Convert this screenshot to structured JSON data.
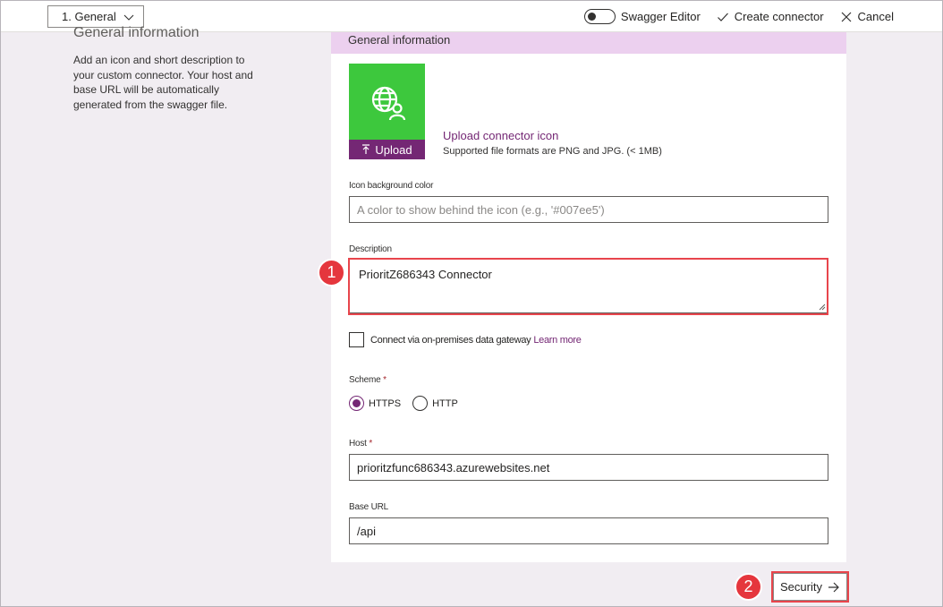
{
  "topbar": {
    "step_dropdown": "1. General",
    "swagger_editor": "Swagger Editor",
    "create_connector": "Create connector",
    "cancel": "Cancel"
  },
  "left": {
    "title": "General information",
    "description": "Add an icon and short description to your custom connector. Your host and base URL will be automatically generated from the swagger file."
  },
  "card": {
    "header": "General information",
    "upload_button": "Upload",
    "upload_link": "Upload connector icon",
    "upload_note": "Supported file formats are PNG and JPG. (< 1MB)",
    "icon_bg_label": "Icon background color",
    "icon_bg_placeholder": "A color to show behind the icon (e.g., '#007ee5')",
    "description_label": "Description",
    "description_value": "PrioritZ686343 Connector",
    "gateway_label": "Connect via on-premises data gateway",
    "learn_more": "Learn more",
    "scheme_label": "Scheme",
    "scheme_options": [
      "HTTPS",
      "HTTP"
    ],
    "scheme_selected": "HTTPS",
    "host_label": "Host",
    "host_value": "prioritzfunc686343.azurewebsites.net",
    "base_url_label": "Base URL",
    "base_url_value": "/api",
    "required_mark": "*"
  },
  "footer": {
    "security_button": "Security"
  },
  "annotations": {
    "badge1": "1",
    "badge2": "2"
  },
  "colors": {
    "accent": "#742774",
    "header_bg": "#ecd0ef",
    "icon_tile": "#3dc83d",
    "highlight": "#e8454c"
  }
}
